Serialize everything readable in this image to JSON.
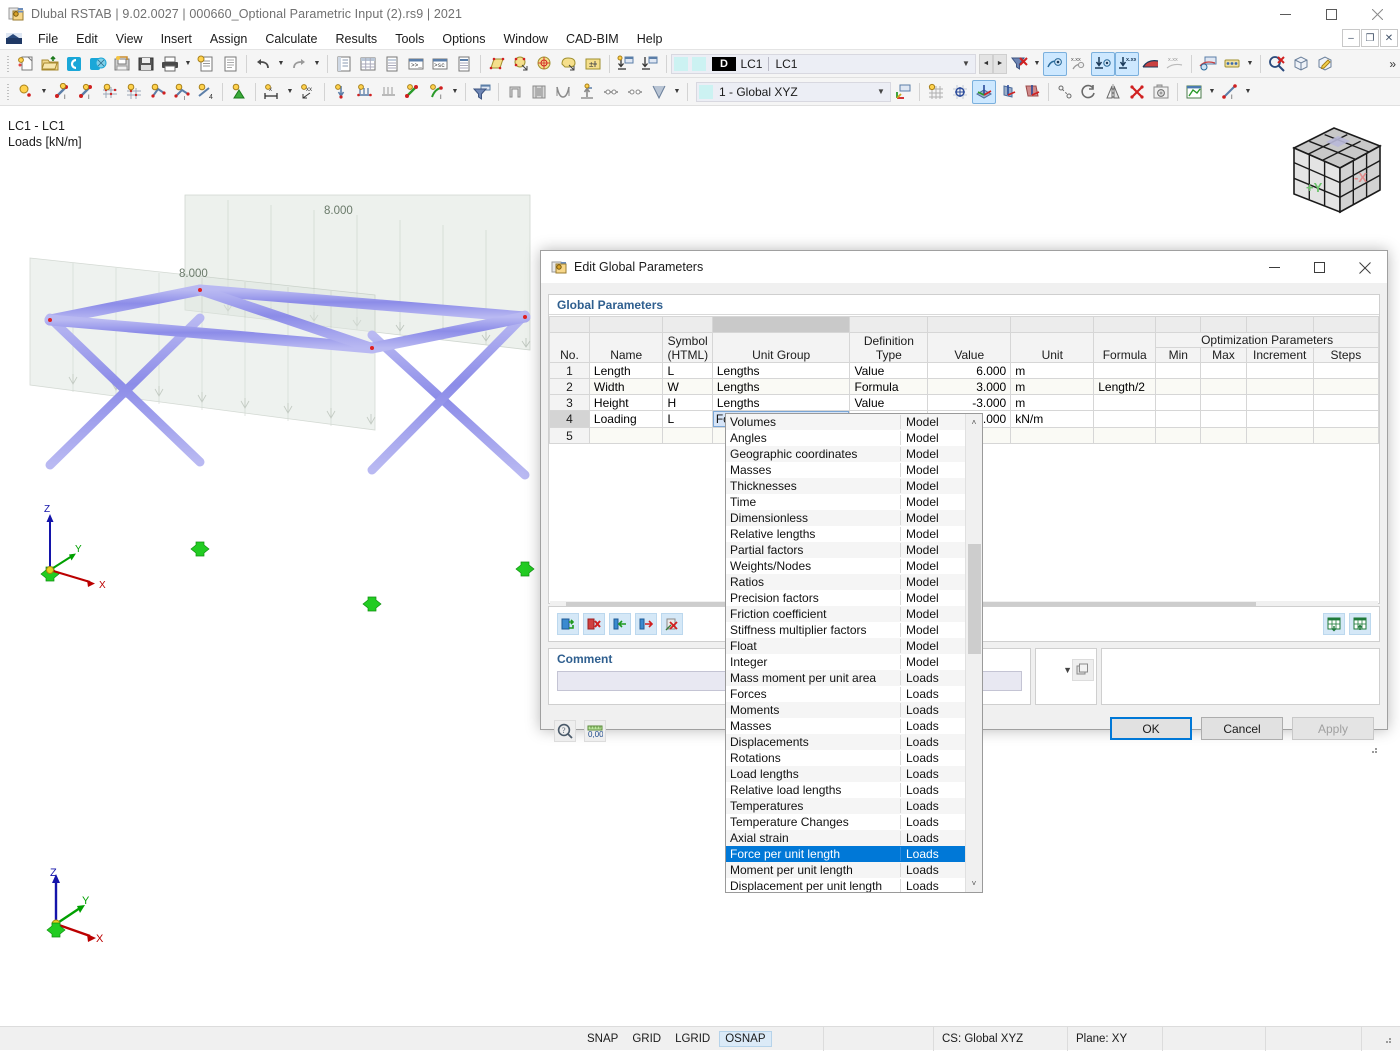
{
  "window": {
    "title": "Dlubal RSTAB | 9.02.0027 | 000660_Optional Parametric Input (2).rs9 | 2021",
    "app_icon": "rstab-icon",
    "minimize": "─",
    "maximize": "□",
    "close": "✕"
  },
  "menubar": {
    "items": [
      {
        "label": "File"
      },
      {
        "label": "Edit"
      },
      {
        "label": "View"
      },
      {
        "label": "Insert"
      },
      {
        "label": "Assign"
      },
      {
        "label": "Calculate"
      },
      {
        "label": "Results"
      },
      {
        "label": "Tools"
      },
      {
        "label": "Options"
      },
      {
        "label": "Window"
      },
      {
        "label": "CAD-BIM"
      },
      {
        "label": "Help"
      }
    ],
    "mdi_minimize": "–",
    "mdi_restore": "❐",
    "mdi_close": "✕"
  },
  "toolbar1": {
    "loadcase_badge": "D",
    "loadcase_no": "LC1",
    "loadcase_name": "LC1",
    "nav_prev": "◄",
    "nav_next": "►",
    "overflow": "»"
  },
  "toolbar2": {
    "cs_value": "1 - Global XYZ"
  },
  "viewport": {
    "label_line1": "LC1 - LC1",
    "label_line2": "Loads [kN/m]",
    "load_value_1": "8.000",
    "load_value_2": "8.000",
    "axis_x": "X",
    "axis_y": "Y",
    "axis_z": "Z",
    "navcube_face_left": "+Y",
    "navcube_face_right": "-X"
  },
  "dialog": {
    "title": "Edit Global Parameters",
    "section_title": "Global Parameters",
    "minimize": "─",
    "maximize": "□",
    "close": "✕",
    "comment_label": "Comment",
    "comment_value": "",
    "columns": {
      "no": "No.",
      "name": "Name",
      "symbol_line1": "Symbol",
      "symbol_line2": "(HTML)",
      "unit_group": "Unit Group",
      "definition_line1": "Definition",
      "definition_line2": "Type",
      "value": "Value",
      "unit": "Unit",
      "formula": "Formula",
      "optimization_group": "Optimization Parameters",
      "min": "Min",
      "max": "Max",
      "increment": "Increment",
      "steps": "Steps"
    },
    "rows": [
      {
        "no": "1",
        "name": "Length",
        "symbol": "L",
        "unit_group": "Lengths",
        "definition_type": "Value",
        "value": "6.000",
        "unit": "m",
        "formula": "",
        "min": "",
        "max": "",
        "increment": "",
        "steps": ""
      },
      {
        "no": "2",
        "name": "Width",
        "symbol": "W",
        "unit_group": "Lengths",
        "definition_type": "Formula",
        "value": "3.000",
        "unit": "m",
        "formula": "Length/2",
        "min": "",
        "max": "",
        "increment": "",
        "steps": ""
      },
      {
        "no": "3",
        "name": "Height",
        "symbol": "H",
        "unit_group": "Lengths",
        "definition_type": "Value",
        "value": "-3.000",
        "unit": "m",
        "formula": "",
        "min": "",
        "max": "",
        "increment": "",
        "steps": ""
      },
      {
        "no": "4",
        "name": "Loading",
        "symbol": "L",
        "unit_group": "Force per unit leng...",
        "definition_type": "Value",
        "value": "8.000",
        "unit": "kN/m",
        "formula": "",
        "min": "",
        "max": "",
        "increment": "",
        "steps": ""
      },
      {
        "no": "5",
        "name": "",
        "symbol": "",
        "unit_group": "",
        "definition_type": "",
        "value": "",
        "unit": "",
        "formula": "",
        "min": "",
        "max": "",
        "increment": "",
        "steps": ""
      }
    ],
    "dropdown": {
      "selected": "Force per unit length",
      "scroll_up": "˄",
      "scroll_down": "˅",
      "options": [
        {
          "label": "Volumes",
          "group": "Model"
        },
        {
          "label": "Angles",
          "group": "Model"
        },
        {
          "label": "Geographic coordinates",
          "group": "Model"
        },
        {
          "label": "Masses",
          "group": "Model"
        },
        {
          "label": "Thicknesses",
          "group": "Model"
        },
        {
          "label": "Time",
          "group": "Model"
        },
        {
          "label": "Dimensionless",
          "group": "Model"
        },
        {
          "label": "Relative lengths",
          "group": "Model"
        },
        {
          "label": "Partial factors",
          "group": "Model"
        },
        {
          "label": "Weights/Nodes",
          "group": "Model"
        },
        {
          "label": "Ratios",
          "group": "Model"
        },
        {
          "label": "Precision factors",
          "group": "Model"
        },
        {
          "label": "Friction coefficient",
          "group": "Model"
        },
        {
          "label": "Stiffness multiplier factors",
          "group": "Model"
        },
        {
          "label": "Float",
          "group": "Model"
        },
        {
          "label": "Integer",
          "group": "Model"
        },
        {
          "label": "Mass moment per unit area",
          "group": "Loads"
        },
        {
          "label": "Forces",
          "group": "Loads"
        },
        {
          "label": "Moments",
          "group": "Loads"
        },
        {
          "label": "Masses",
          "group": "Loads"
        },
        {
          "label": "Displacements",
          "group": "Loads"
        },
        {
          "label": "Rotations",
          "group": "Loads"
        },
        {
          "label": "Load lengths",
          "group": "Loads"
        },
        {
          "label": "Relative load lengths",
          "group": "Loads"
        },
        {
          "label": "Temperatures",
          "group": "Loads"
        },
        {
          "label": "Temperature Changes",
          "group": "Loads"
        },
        {
          "label": "Axial strain",
          "group": "Loads"
        },
        {
          "label": "Force per unit length",
          "group": "Loads"
        },
        {
          "label": "Moment per unit length",
          "group": "Loads"
        },
        {
          "label": "Displacement per unit length",
          "group": "Loads"
        }
      ]
    },
    "buttons": {
      "ok": "OK",
      "cancel": "Cancel",
      "apply": "Apply"
    },
    "row_tools": [
      {
        "icon": "new-row-icon"
      },
      {
        "icon": "delete-row-icon"
      },
      {
        "icon": "insert-row-icon"
      },
      {
        "icon": "move-row-icon"
      },
      {
        "icon": "clear-row-icon"
      }
    ],
    "excel_tools": [
      {
        "icon": "excel-import-icon"
      },
      {
        "icon": "excel-export-icon"
      }
    ],
    "footer_tools": [
      {
        "icon": "help-info-icon"
      },
      {
        "icon": "units-decimal-icon"
      }
    ],
    "scroll_left": "‹",
    "scroll_right": "›"
  },
  "statusbar": {
    "snap": "SNAP",
    "grid": "GRID",
    "lgrid": "LGRID",
    "osnap": "OSNAP",
    "cs": "CS: Global XYZ",
    "plane": "Plane: XY"
  },
  "colors": {
    "accent": "#0078d7",
    "dialog_header_text": "#2f5f8f",
    "member_blue": "#8f8fe8",
    "support_green": "#22bb22",
    "axis_x": "#cc0000",
    "axis_y": "#00aa00",
    "axis_z": "#0000cc"
  }
}
